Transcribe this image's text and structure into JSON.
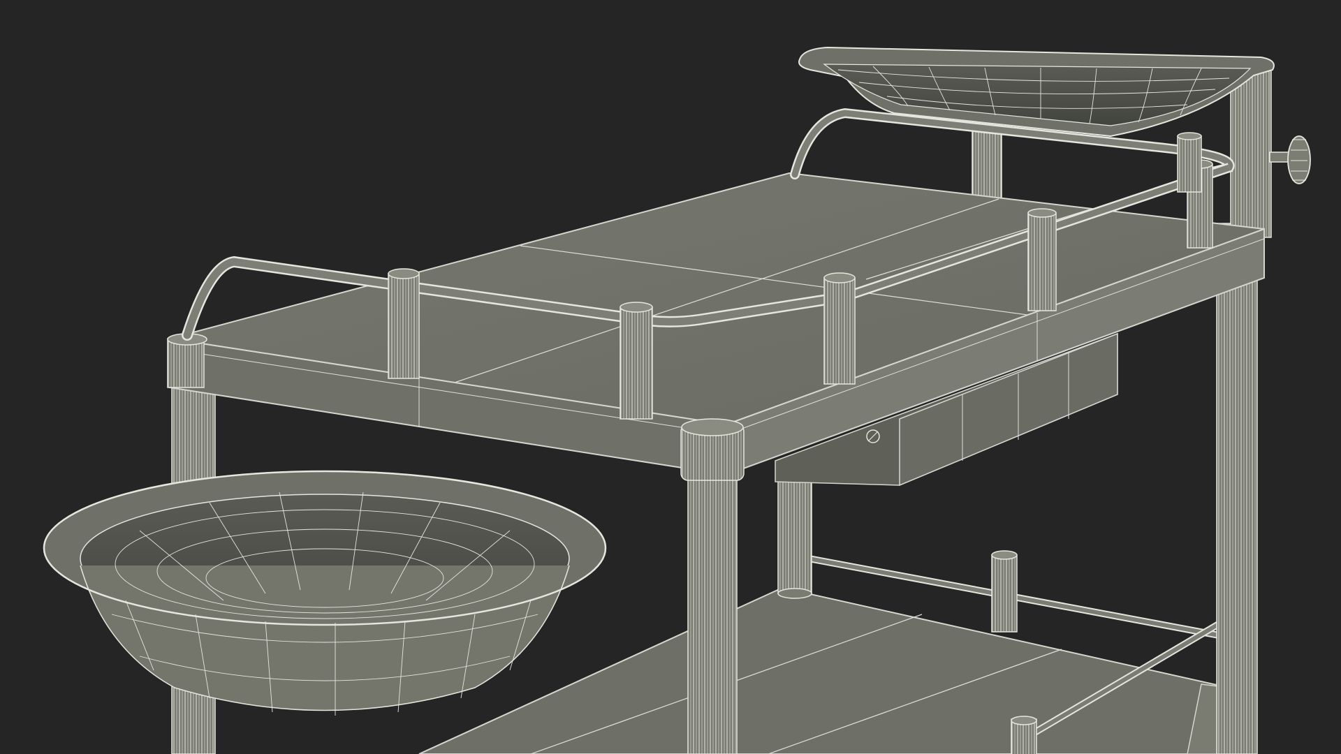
{
  "scene": {
    "subject": "medical-trolley-wireframe-render",
    "colors": {
      "background": "#252525",
      "surface": "#74766c",
      "surface_dark": "#5f6159",
      "surface_light": "#8a8c82",
      "edge": "#d6d6cf",
      "wire": "#e9e9e2"
    }
  }
}
